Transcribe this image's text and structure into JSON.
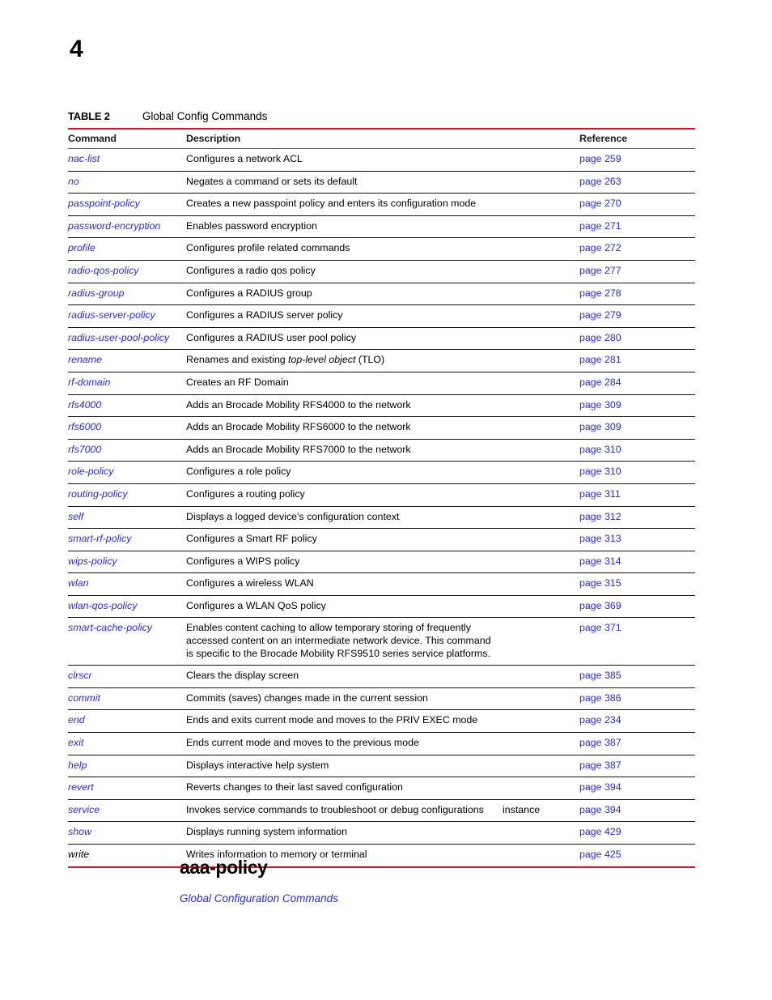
{
  "page": {
    "number": "4"
  },
  "table_caption": {
    "label": "TABLE 2",
    "title": "Global Config Commands"
  },
  "table": {
    "headers": {
      "command": "Command",
      "description": "Description",
      "reference": "Reference"
    },
    "rows": [
      {
        "command": "nac-list",
        "command_link": true,
        "description": "Configures a network ACL",
        "extra": "",
        "reference": "page 259"
      },
      {
        "command": "no",
        "command_link": true,
        "description": "Negates a command or sets its default",
        "extra": "",
        "reference": "page 263"
      },
      {
        "command": "passpoint-policy",
        "command_link": true,
        "description": "Creates a new passpoint policy and enters its configuration mode",
        "extra": "",
        "reference": "page 270"
      },
      {
        "command": "password-encryption",
        "command_link": true,
        "description": "Enables password encryption",
        "extra": "",
        "reference": "page 271"
      },
      {
        "command": "profile",
        "command_link": true,
        "description": "Configures profile related commands",
        "extra": "",
        "reference": "page 272"
      },
      {
        "command": "radio-qos-policy",
        "command_link": true,
        "description": "Configures a radio qos policy",
        "extra": "",
        "reference": "page 277"
      },
      {
        "command": "radius-group",
        "command_link": true,
        "description": "Configures a RADIUS group",
        "extra": "",
        "reference": "page 278"
      },
      {
        "command": "radius-server-policy",
        "command_link": true,
        "description": "Configures a RADIUS server policy",
        "extra": "",
        "reference": "page 279"
      },
      {
        "command": "radius-user-pool-policy",
        "command_link": true,
        "description": "Configures a RADIUS user pool policy",
        "extra": "",
        "reference": "page 280"
      },
      {
        "command": "rename",
        "command_link": true,
        "description_html": "Renames and existing <em>top-level object</em> (TLO)",
        "description": "Renames and existing top-level object (TLO)",
        "extra": "",
        "reference": "page 281"
      },
      {
        "command": "rf-domain",
        "command_link": true,
        "description": "Creates an RF Domain",
        "extra": "",
        "reference": "page 284"
      },
      {
        "command": "rfs4000",
        "command_link": true,
        "description": "Adds an Brocade Mobility RFS4000 to the network",
        "extra": "",
        "reference": "page 309"
      },
      {
        "command": "rfs6000",
        "command_link": true,
        "description": "Adds an Brocade Mobility RFS6000 to the network",
        "extra": "",
        "reference": "page 309"
      },
      {
        "command": "rfs7000",
        "command_link": true,
        "description": "Adds an Brocade Mobility RFS7000 to the network",
        "extra": "",
        "reference": "page 310"
      },
      {
        "command": "role-policy",
        "command_link": true,
        "description": "Configures a role policy",
        "extra": "",
        "reference": "page 310"
      },
      {
        "command": "routing-policy",
        "command_link": true,
        "description": "Configures a routing policy",
        "extra": "",
        "reference": "page 311"
      },
      {
        "command": "self",
        "command_link": true,
        "description": "Displays a logged device's configuration context",
        "extra": "",
        "reference": "page 312"
      },
      {
        "command": "smart-rf-policy",
        "command_link": true,
        "description": "Configures a Smart RF policy",
        "extra": "",
        "reference": "page 313"
      },
      {
        "command": "wips-policy",
        "command_link": true,
        "description": "Configures a WIPS policy",
        "extra": "",
        "reference": "page 314"
      },
      {
        "command": "wlan",
        "command_link": true,
        "description": "Configures a wireless WLAN",
        "extra": "",
        "reference": "page 315"
      },
      {
        "command": "wlan-qos-policy",
        "command_link": true,
        "description": "Configures a WLAN QoS policy",
        "extra": "",
        "reference": "page 369"
      },
      {
        "command": "smart-cache-policy",
        "command_link": true,
        "description": "Enables content caching to allow temporary storing of frequently accessed content on an intermediate network device. This command is specific to the Brocade Mobility RFS9510 series service platforms.",
        "extra": "",
        "reference": "page 371"
      },
      {
        "command": "clrscr",
        "command_link": true,
        "description": "Clears the display screen",
        "extra": "",
        "reference": "page 385"
      },
      {
        "command": "commit",
        "command_link": true,
        "description": "Commits (saves) changes made in the current session",
        "extra": "",
        "reference": "page 386"
      },
      {
        "command": "end",
        "command_link": true,
        "description": "Ends and exits current mode and moves to the PRIV EXEC mode",
        "extra": "",
        "reference": "page 234"
      },
      {
        "command": "exit",
        "command_link": true,
        "description": "Ends current mode and moves to the previous mode",
        "extra": "",
        "reference": "page 387"
      },
      {
        "command": "help",
        "command_link": true,
        "description": "Displays interactive help system",
        "extra": "",
        "reference": "page 387"
      },
      {
        "command": "revert",
        "command_link": true,
        "description": "Reverts changes to their last saved configuration",
        "extra": "",
        "reference": "page 394"
      },
      {
        "command": "service",
        "command_link": true,
        "description": "Invokes service commands to troubleshoot or debug configurations",
        "extra": "instance",
        "reference": "page 394"
      },
      {
        "command": "show",
        "command_link": true,
        "description": "Displays running system information",
        "extra": "",
        "reference": "page 429"
      },
      {
        "command": "write",
        "command_link": false,
        "description": "Writes information to memory or terminal",
        "extra": "",
        "reference": "page 425"
      }
    ]
  },
  "section": {
    "heading": "aaa-policy",
    "subheading": "Global Configuration Commands"
  },
  "colors": {
    "link_blue": "#2a2ae0",
    "rule_red": "#e8112d",
    "text_black": "#000000"
  }
}
